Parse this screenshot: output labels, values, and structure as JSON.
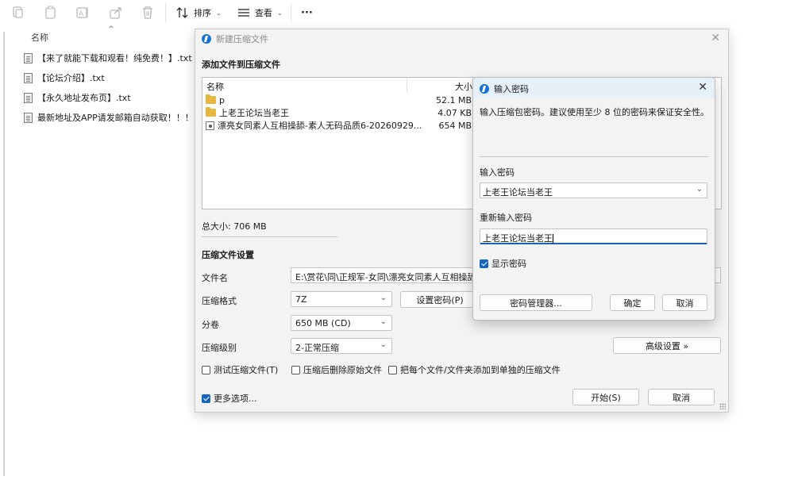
{
  "toolbar": {
    "icons": [
      "cut-icon",
      "copy-icon",
      "rename-icon",
      "share-icon",
      "delete-icon"
    ],
    "sort_label": "排序",
    "view_label": "查看",
    "more_label": "···"
  },
  "explorer": {
    "column_name": "名称",
    "files": [
      "【来了就能下载和观看！纯免费！】.txt",
      "【论坛介绍】.txt",
      "【永久地址发布页】.txt",
      "最新地址及APP请发邮箱自动获取！！！..."
    ]
  },
  "main_dialog": {
    "title": "新建压缩文件",
    "add_files_heading": "添加文件到压缩文件",
    "list_header_name": "名称",
    "list_header_size": "大小",
    "items": [
      {
        "type": "folder",
        "name": "p",
        "size": "52.1 MB"
      },
      {
        "type": "folder",
        "name": "上老王论坛当老王",
        "size": "4.07 KB"
      },
      {
        "type": "archive",
        "name": "漂亮女同素人互相操舔-素人无码品质6-20260929...",
        "size": "654 MB"
      }
    ],
    "total_size": "总大小: 706 MB",
    "settings_heading": "压缩文件设置",
    "filename_label": "文件名",
    "filename_value": "E:\\赏花\\同\\正规军-女同\\漂亮女同素人互相操舔-素",
    "format_label": "压缩格式",
    "format_value": "7Z",
    "set_password_button": "设置密码(P)",
    "split_label": "分卷",
    "split_value": "650 MB (CD)",
    "level_label": "压缩级别",
    "level_value": "2-正常压缩",
    "advanced_button": "高级设置 »",
    "test_checkbox": "测试压缩文件(T)",
    "delete_checkbox": "压缩后删除原始文件",
    "separate_checkbox": "把每个文件/文件夹添加到单独的压缩文件",
    "more_options": "更多选项...",
    "start_button": "开始(S)",
    "cancel_button": "取消"
  },
  "password_dialog": {
    "title": "输入密码",
    "instruction": "输入压缩包密码。建议使用至少 8 位的密码来保证安全性。",
    "enter_label": "输入密码",
    "enter_value": "上老王论坛当老王",
    "reenter_label": "重新输入密码",
    "reenter_value": "上老王论坛当老王",
    "show_password": "显示密码",
    "show_password_checked": true,
    "manager_button": "密码管理器...",
    "ok_button": "确定",
    "cancel_button": "取消"
  },
  "colors": {
    "accent": "#1565c0",
    "folder": "#e8b73f",
    "titlebar_active": "#e6f0f8"
  }
}
